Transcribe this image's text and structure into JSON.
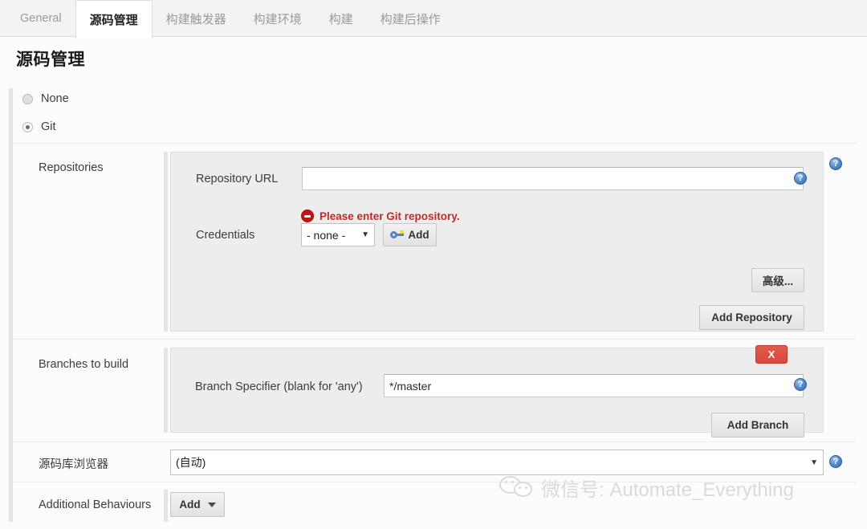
{
  "tabs": [
    {
      "label": "General",
      "active": false,
      "cjk": false
    },
    {
      "label": "源码管理",
      "active": true,
      "cjk": true
    },
    {
      "label": "构建触发器",
      "active": false,
      "cjk": true
    },
    {
      "label": "构建环境",
      "active": false,
      "cjk": true
    },
    {
      "label": "构建",
      "active": false,
      "cjk": true
    },
    {
      "label": "构建后操作",
      "active": false,
      "cjk": true
    }
  ],
  "page": {
    "title": "源码管理"
  },
  "scm_options": [
    {
      "label": "None",
      "selected": false
    },
    {
      "label": "Git",
      "selected": true
    }
  ],
  "repositories": {
    "section_label": "Repositories",
    "repository_url_label": "Repository URL",
    "repository_url_value": "",
    "error_message": "Please enter Git repository.",
    "credentials_label": "Credentials",
    "credentials_value": "- none -",
    "credentials_add_label": "Add",
    "advanced_button": "高级...",
    "add_repository_button": "Add Repository",
    "help_icon": "help-icon"
  },
  "branches": {
    "section_label": "Branches to build",
    "branch_specifier_label": "Branch Specifier (blank for 'any')",
    "branch_specifier_value": "*/master",
    "delete_button": "X",
    "add_branch_button": "Add Branch"
  },
  "repo_browser": {
    "label": "源码库浏览器",
    "value": "(自动)"
  },
  "additional_behaviours": {
    "label": "Additional Behaviours",
    "add_button": "Add"
  },
  "watermark": {
    "text": "微信号: Automate_Everything",
    "logo": "wechat-logo"
  },
  "colors": {
    "accent_red": "#cc1111",
    "delete_red": "#d9483a",
    "help_blue": "#2f6bb0",
    "panel_bg": "#ededed",
    "tab_bar_bg": "#f3f3f3"
  }
}
